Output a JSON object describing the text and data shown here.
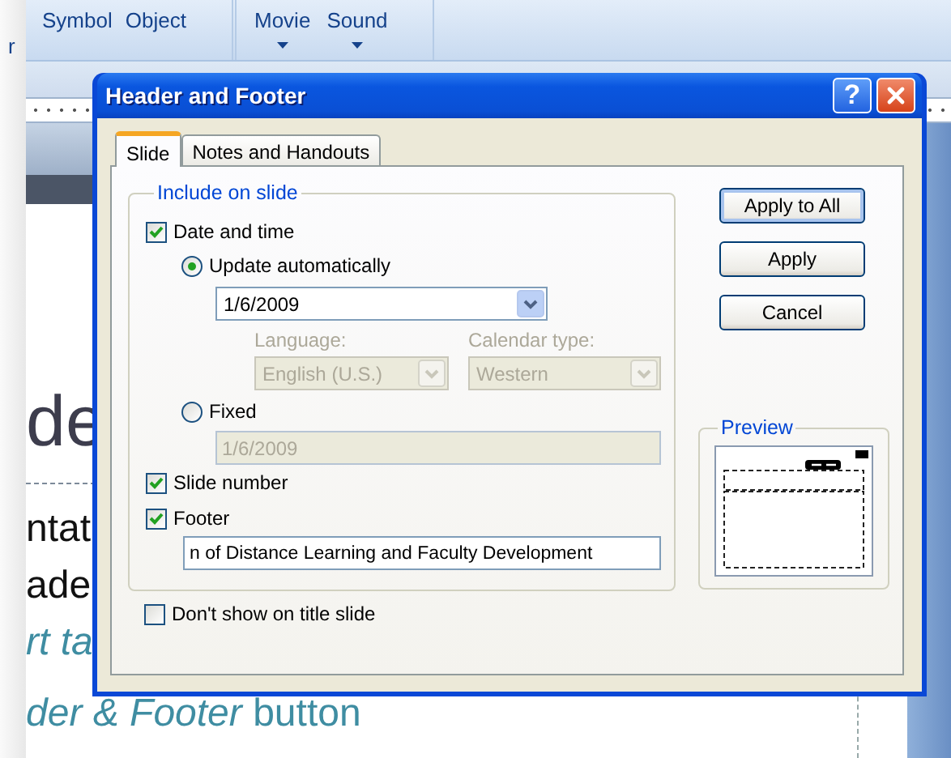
{
  "ribbon": {
    "cut_label": "r",
    "groups": [
      {
        "items": [
          {
            "label": "Symbol",
            "has_menu": false
          },
          {
            "label": "Object",
            "has_menu": false
          }
        ]
      },
      {
        "items": [
          {
            "label": "Movie",
            "has_menu": true
          },
          {
            "label": "Sound",
            "has_menu": true
          }
        ]
      }
    ]
  },
  "slide": {
    "lines": [
      {
        "text": "de",
        "kind": "title"
      },
      {
        "text": "ntat",
        "kind": "body"
      },
      {
        "text": "ade",
        "kind": "body"
      },
      {
        "text": "rt ta",
        "kind": "italic_note"
      },
      {
        "text": "*der & Footer* button",
        "kind": "note"
      }
    ]
  },
  "dialog": {
    "title": "Header and Footer",
    "help_button": "?",
    "tabs": [
      {
        "label": "Slide",
        "selected": true
      },
      {
        "label": "Notes and Handouts",
        "selected": false
      }
    ],
    "group_title": "Include on slide",
    "date_and_time": {
      "label": "Date and time",
      "checked": true
    },
    "update_automatically": {
      "label": "Update automatically",
      "selected": true
    },
    "date_value": "1/6/2009",
    "language": {
      "label": "Language:",
      "value": "English (U.S.)",
      "disabled": true
    },
    "calendar_type": {
      "label": "Calendar type:",
      "value": "Western",
      "disabled": true
    },
    "fixed": {
      "label": "Fixed",
      "selected": false
    },
    "fixed_value": {
      "value": "1/6/2009",
      "disabled": true
    },
    "slide_number": {
      "label": "Slide number",
      "checked": true
    },
    "footer": {
      "label": "Footer",
      "checked": true,
      "value": "n of Distance Learning and Faculty Development"
    },
    "dont_show_on_title_slide": {
      "label": "Don't show on title slide",
      "checked": false
    },
    "buttons": [
      {
        "label": "Apply to All",
        "default": true
      },
      {
        "label": "Apply",
        "default": false
      },
      {
        "label": "Cancel",
        "default": false
      }
    ],
    "preview_title": "Preview"
  }
}
